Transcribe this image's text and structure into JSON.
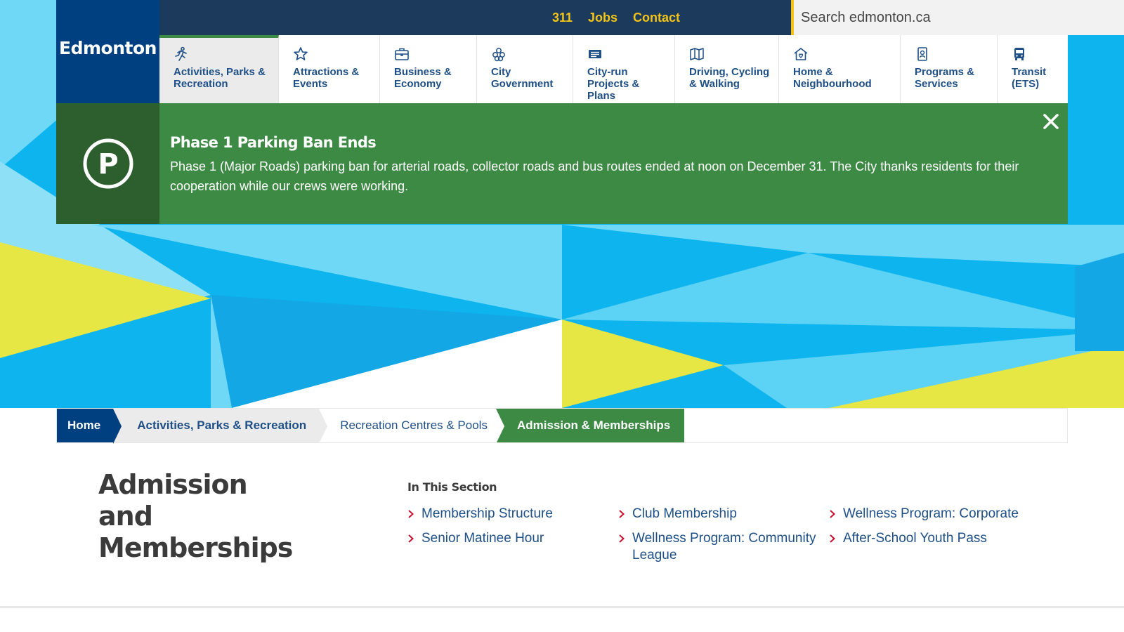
{
  "site": {
    "logo_text": "Edmonton"
  },
  "utility": {
    "links": [
      "311",
      "Jobs",
      "Contact"
    ],
    "search_placeholder": "Search edmonton.ca"
  },
  "nav": [
    {
      "label": "Activities, Parks & Recreation",
      "icon": "running-person-icon",
      "active": true
    },
    {
      "label": "Attractions & Events",
      "icon": "star-icon"
    },
    {
      "label": "Business & Economy",
      "icon": "briefcase-icon"
    },
    {
      "label": "City Government",
      "icon": "government-icon"
    },
    {
      "label": "City-run Projects & Plans",
      "icon": "projects-icon"
    },
    {
      "label": "Driving, Cycling & Walking",
      "icon": "map-icon"
    },
    {
      "label": "Home & Neighbourhood",
      "icon": "home-icon"
    },
    {
      "label": "Programs & Services",
      "icon": "id-badge-icon"
    },
    {
      "label": "Transit (ETS)",
      "icon": "bus-icon"
    }
  ],
  "alert": {
    "icon": "parking-icon",
    "title": "Phase 1 Parking Ban Ends",
    "text": "Phase 1 (Major Roads) parking ban for arterial roads, collector roads and bus routes ended at noon on December 31. The City thanks residents for their cooperation while our crews were working."
  },
  "breadcrumb": {
    "home": "Home",
    "level2": "Activities, Parks & Recreation",
    "level3": "Recreation Centres & Pools",
    "current": "Admission & Memberships"
  },
  "page": {
    "title": "Admission and Memberships"
  },
  "section": {
    "heading": "In This Section",
    "columns": [
      [
        "Membership Structure",
        "Senior Matinee Hour"
      ],
      [
        "Club Membership",
        "Wellness Program: Community League"
      ],
      [
        "Wellness Program: Corporate",
        "After-School Youth Pass"
      ]
    ]
  },
  "colors": {
    "navy": "#004080",
    "dark_navy": "#1b3a5c",
    "accent_yellow": "#f3c318",
    "alert_green": "#3d8a44",
    "link_blue": "#1e4f86"
  }
}
